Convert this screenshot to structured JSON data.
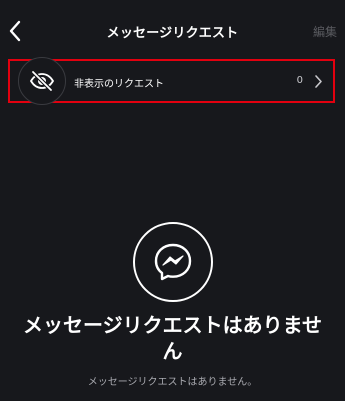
{
  "header": {
    "title": "メッセージリクエスト",
    "edit_label": "編集",
    "back_icon": "chevron-left-icon"
  },
  "hidden_requests": {
    "label": "非表示のリクエスト",
    "count": "0",
    "icon": "eye-slash-icon",
    "chevron_icon": "chevron-right-icon",
    "highlight_color": "#e3000f"
  },
  "empty_state": {
    "icon": "messenger-icon",
    "title": "メッセージリクエストはありません",
    "subtitle": "メッセージリクエストはありません。"
  },
  "colors": {
    "background": "#17181c",
    "text": "#ffffff",
    "muted": "#5a5b60"
  }
}
